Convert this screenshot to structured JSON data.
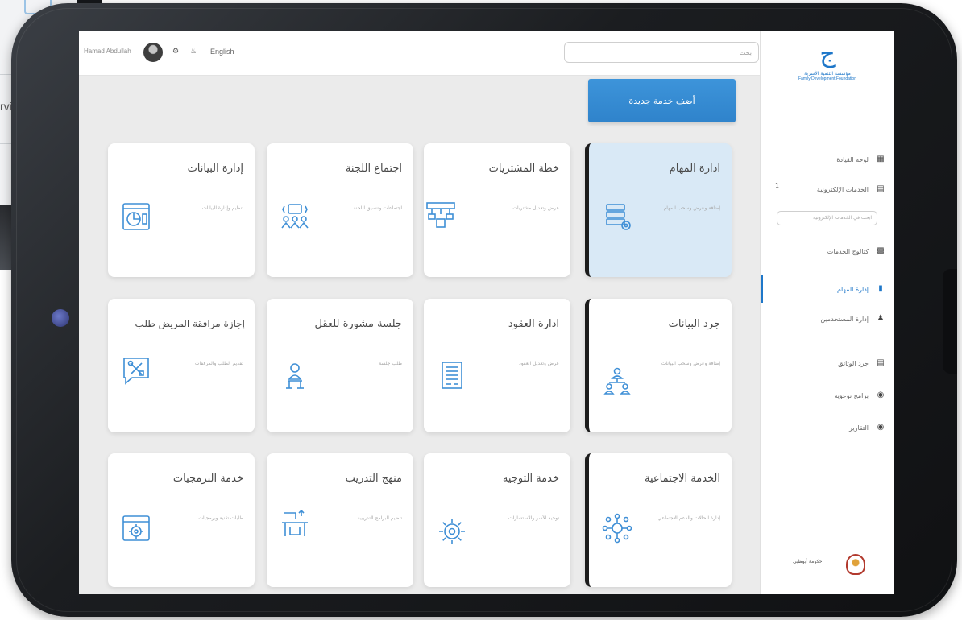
{
  "background": {
    "fragment_text": "rvi"
  },
  "topbar": {
    "user_name": "Hamad Abdullah",
    "language": "English",
    "search_placeholder": "بحث"
  },
  "sidebar": {
    "logo": {
      "org_ar": "مؤسسة التنمية الأسرية",
      "org_en": "Family Development Foundation"
    },
    "items": [
      {
        "label": "لوحة القيادة",
        "icon": "dashboard-icon"
      },
      {
        "label": "الخدمات الإلكترونية",
        "icon": "services-icon",
        "count": "1"
      },
      {
        "label": "كتالوج الخدمات",
        "icon": "catalog-icon"
      },
      {
        "label": "إدارة المهام",
        "icon": "tasks-icon",
        "active": true
      },
      {
        "label": "إدارة المستخدمين",
        "icon": "users-icon"
      },
      {
        "label": "جرد الوثائق",
        "icon": "documents-icon"
      },
      {
        "label": "برامج توعوية",
        "icon": "programs-icon"
      },
      {
        "label": "التقارير",
        "icon": "reports-icon"
      }
    ],
    "sub_search_placeholder": "ابحث في الخدمات الإلكترونية",
    "gov_logo_text": "حكومة أبوظبي"
  },
  "main": {
    "add_button_label": "أضف خدمة جديدة",
    "cards": [
      {
        "title": "ادارة المهام",
        "desc": "إضافة وعرض وسحب المهام",
        "icon": "server-settings-icon"
      },
      {
        "title": "خطة المشتريات",
        "desc": "عرض وتعديل مشتريات",
        "icon": "network-icon"
      },
      {
        "title": "اجتماع اللجنة",
        "desc": "اجتماعات وتنسيق اللجنة",
        "icon": "meeting-icon"
      },
      {
        "title": "إدارة البيانات",
        "desc": "تنظيم وإدارة البيانات",
        "icon": "data-chart-icon"
      },
      {
        "title": "جرد البيانات",
        "desc": "إضافة وعرض وسحب البيانات",
        "icon": "hierarchy-icon"
      },
      {
        "title": "ادارة العقود",
        "desc": "عرض وتعديل العقود",
        "icon": "contract-icon"
      },
      {
        "title": "جلسة مشورة للعقل",
        "desc": "طلب جلسة",
        "icon": "counseling-icon"
      },
      {
        "title": "إجازة مرافقة المريض طلب",
        "desc": "تقديم الطلب والمرفقات",
        "icon": "tools-chat-icon"
      },
      {
        "title": "الخدمة الاجتماعية",
        "desc": "إدارة الحالات والدعم الاجتماعي",
        "icon": "social-network-icon"
      },
      {
        "title": "خدمة التوجيه",
        "desc": "توجيه الأسر والاستشارات",
        "icon": "guidance-gear-icon"
      },
      {
        "title": "منهج التدريب",
        "desc": "تنظيم البرامج التدريبية",
        "icon": "training-icon"
      },
      {
        "title": "خدمة البرمجيات",
        "desc": "طلبات تقنية وبرمجيات",
        "icon": "software-icon"
      }
    ]
  },
  "colors": {
    "accent": "#1e77c9",
    "button": "#3589d1",
    "card_highlight": "#d9e9f6",
    "screen_bg": "#ebebeb"
  }
}
